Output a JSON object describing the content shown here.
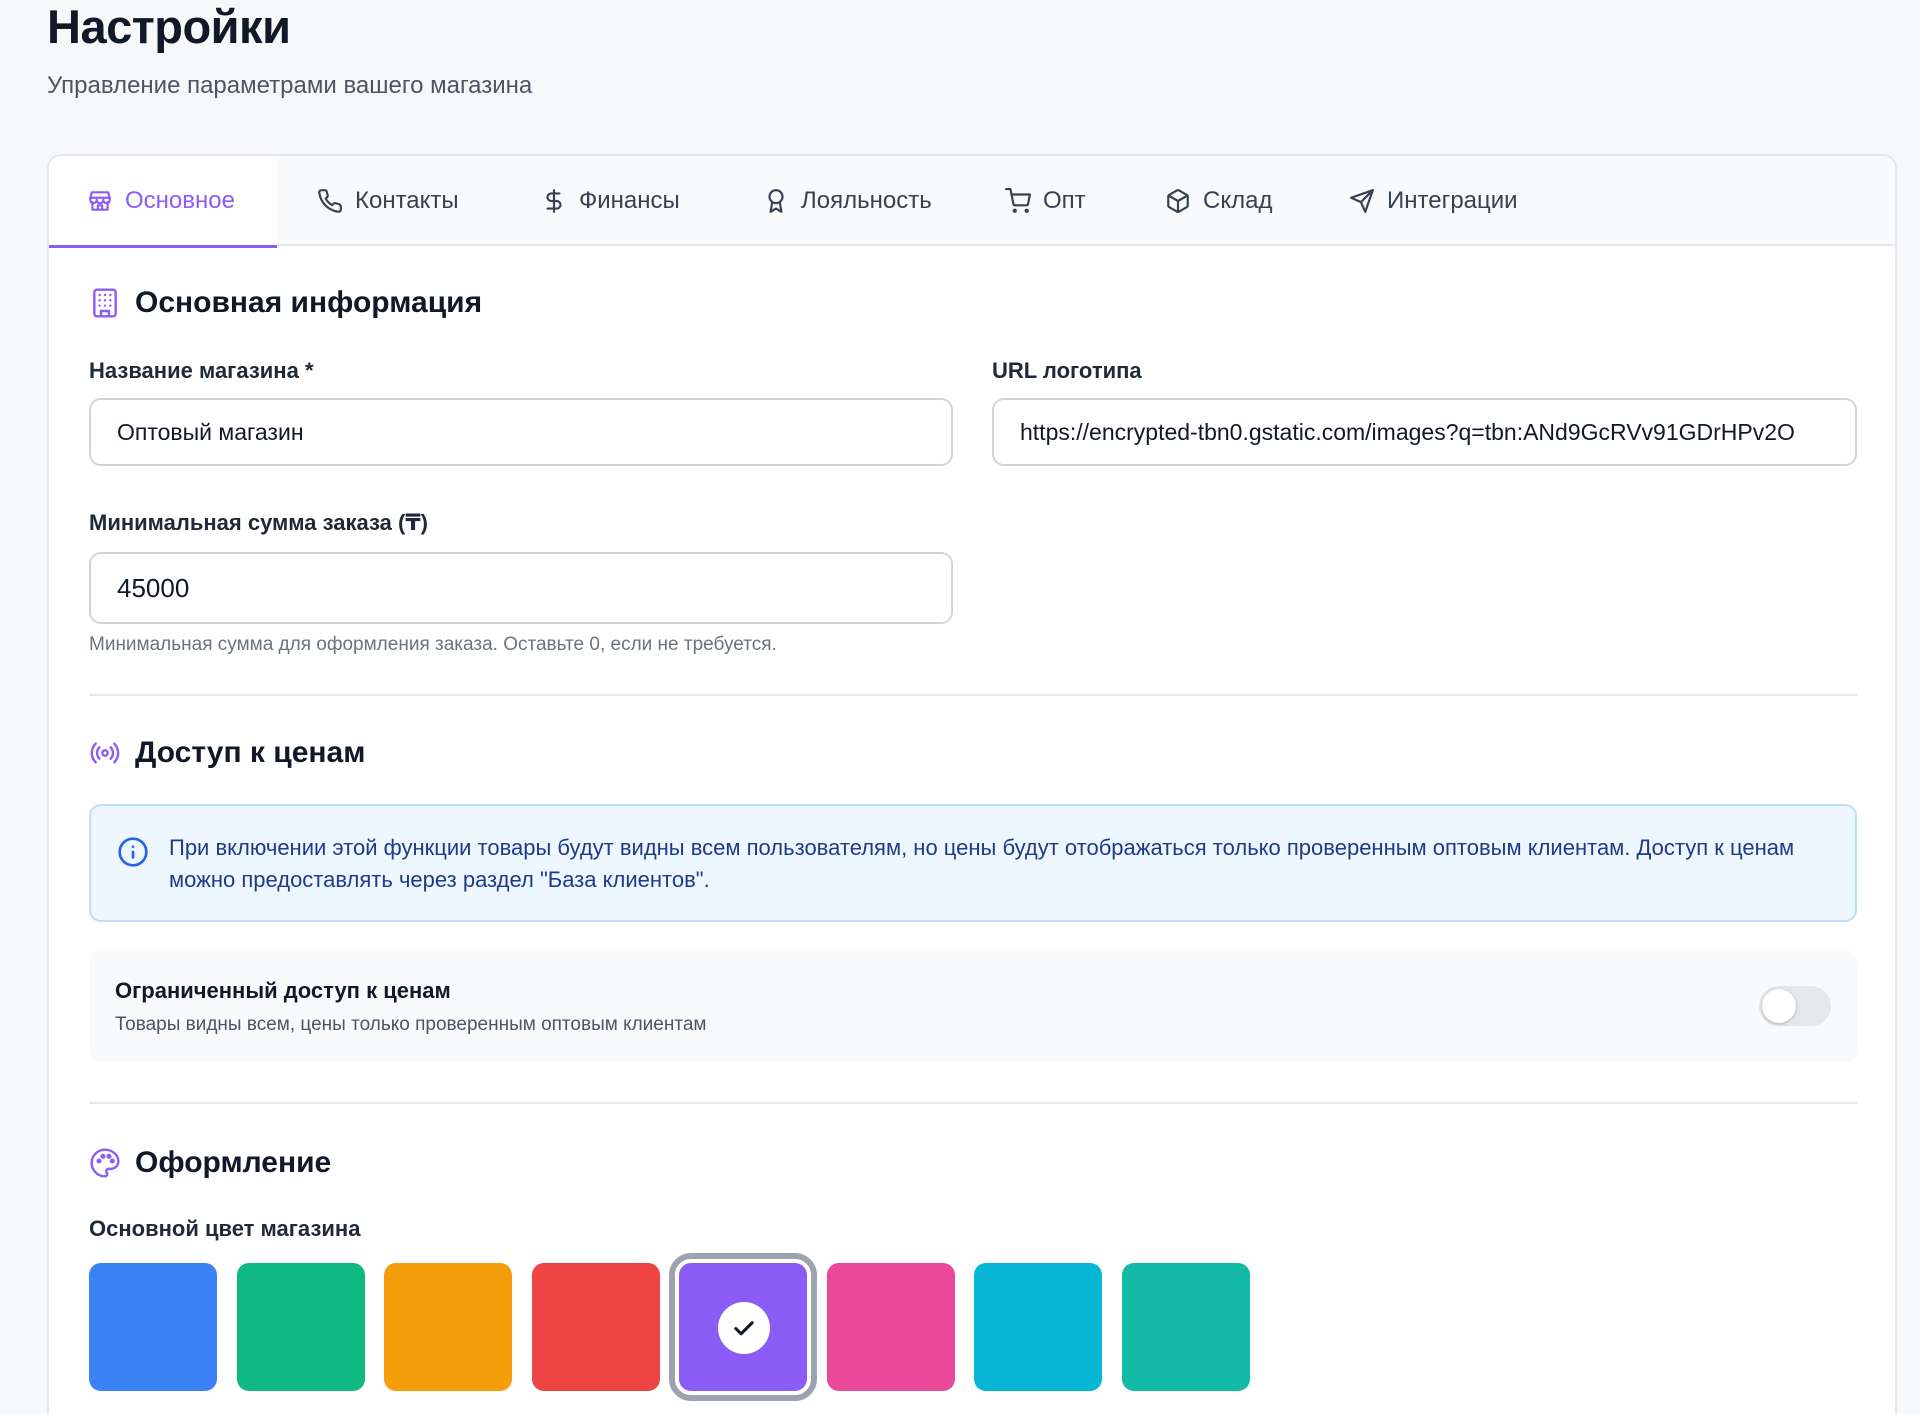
{
  "header": {
    "title": "Настройки",
    "subtitle": "Управление параметрами вашего магазина"
  },
  "tabs": [
    {
      "label": "Основное",
      "icon": "store-icon",
      "active": true
    },
    {
      "label": "Контакты",
      "icon": "phone-icon",
      "active": false
    },
    {
      "label": "Финансы",
      "icon": "dollar-icon",
      "active": false
    },
    {
      "label": "Лояльность",
      "icon": "award-icon",
      "active": false
    },
    {
      "label": "Опт",
      "icon": "cart-icon",
      "active": false
    },
    {
      "label": "Склад",
      "icon": "package-icon",
      "active": false
    },
    {
      "label": "Интеграции",
      "icon": "send-icon",
      "active": false
    }
  ],
  "basic_info": {
    "title": "Основная информация",
    "store_name_label": "Название магазина *",
    "store_name_value": "Оптовый магазин",
    "logo_url_label": "URL логотипа",
    "logo_url_value": "https://encrypted-tbn0.gstatic.com/images?q=tbn:ANd9GcRVv91GDrHPv2O",
    "min_order_label": "Минимальная сумма заказа (₸)",
    "min_order_value": "45000",
    "min_order_hint": "Минимальная сумма для оформления заказа. Оставьте 0, если не требуется."
  },
  "price_access": {
    "title": "Доступ к ценам",
    "info_text": "При включении этой функции товары будут видны всем пользователям, но цены будут отображаться только проверенным оптовым клиентам. Доступ к ценам можно предоставлять через раздел \"База клиентов\".",
    "toggle_title": "Ограниченный доступ к ценам",
    "toggle_desc": "Товары видны всем, цены только проверенным оптовым клиентам",
    "toggle_on": false
  },
  "appearance": {
    "title": "Оформление",
    "color_label": "Основной цвет магазина",
    "colors": [
      "#3b82f6",
      "#10b981",
      "#f59e0b",
      "#ef4444",
      "#8b5cf6",
      "#ec4899",
      "#06b6d4",
      "#14b8a6"
    ],
    "selected_index": 4
  },
  "accent_color": "#8b5cf6"
}
